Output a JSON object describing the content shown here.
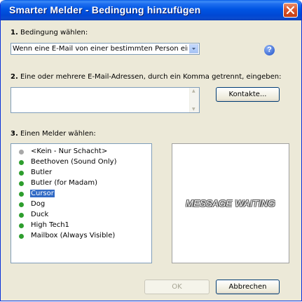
{
  "window": {
    "title": "Smarter Melder - Bedingung hinzufügen"
  },
  "section1": {
    "number": "1.",
    "label": "Bedingung wählen:",
    "selected_condition": "Wenn eine E-Mail von einer bestimmten Person eintrif"
  },
  "section2": {
    "number": "2.",
    "label": "Eine oder mehrere E-Mail-Adressen, durch ein Komma getrennt, eingeben:",
    "email_value": "",
    "contacts_button": "Kontakte..."
  },
  "section3": {
    "number": "3.",
    "label": "Einen Melder wählen:",
    "items": [
      {
        "label": "<Kein - Nur Schacht>",
        "dot": "#a8a8a8",
        "selected": false
      },
      {
        "label": "Beethoven (Sound Only)",
        "dot": "#2e9e2e",
        "selected": false
      },
      {
        "label": "Butler",
        "dot": "#2e9e2e",
        "selected": false
      },
      {
        "label": "Butler (for Madam)",
        "dot": "#2e9e2e",
        "selected": false
      },
      {
        "label": "Cursor",
        "dot": "#2e9e2e",
        "selected": true
      },
      {
        "label": "Dog",
        "dot": "#2e9e2e",
        "selected": false
      },
      {
        "label": "Duck",
        "dot": "#2e9e2e",
        "selected": false
      },
      {
        "label": "High Tech1",
        "dot": "#2e9e2e",
        "selected": false
      },
      {
        "label": "Mailbox (Always Visible)",
        "dot": "#2e9e2e",
        "selected": false
      }
    ],
    "preview_text": "MESSAGE WAITING"
  },
  "buttons": {
    "ok": "OK",
    "cancel": "Abbrechen"
  },
  "icons": {
    "close": "close-icon",
    "help": "help-icon",
    "dropdown": "chevron-down-icon"
  },
  "colors": {
    "titlebar": "#0055e3",
    "selection": "#316ac5",
    "status_dot_active": "#2e9e2e",
    "status_dot_inactive": "#a8a8a8"
  }
}
